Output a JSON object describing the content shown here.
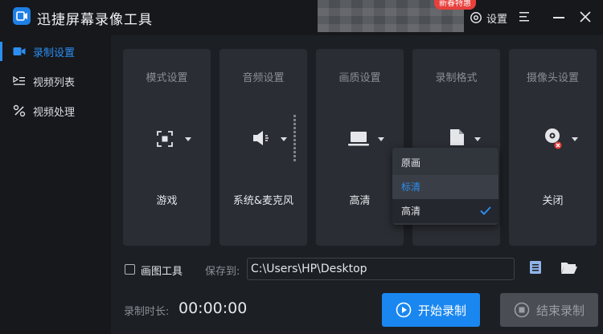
{
  "app": {
    "title": "迅捷屏幕录像工具",
    "promo": "新春特惠"
  },
  "titlebar": {
    "settings_label": "设置"
  },
  "sidebar": {
    "items": [
      {
        "label": "录制设置",
        "icon": "video-camera-icon",
        "active": true
      },
      {
        "label": "视频列表",
        "icon": "video-list-icon",
        "active": false
      },
      {
        "label": "视频处理",
        "icon": "video-tools-icon",
        "active": false
      }
    ]
  },
  "cards": {
    "mode": {
      "title": "模式设置",
      "value": "游戏",
      "icon": "fullscreen-target-icon"
    },
    "audio": {
      "title": "音频设置",
      "value": "系统&麦克风",
      "icon": "speaker-icon"
    },
    "quality": {
      "title": "画质设置",
      "value": "高清",
      "icon": "monitor-icon"
    },
    "format": {
      "title": "录制格式",
      "value": "",
      "icon": "file-icon"
    },
    "camera": {
      "title": "摄像头设置",
      "value": "关闭",
      "icon": "webcam-off-icon"
    }
  },
  "quality_dropdown": {
    "options": [
      "原画",
      "标清",
      "高清"
    ],
    "hovered": "标清",
    "selected": "高清"
  },
  "save": {
    "draw_tool_label": "画图工具",
    "draw_tool_checked": false,
    "save_to_label": "保存到:",
    "path": "C:\\Users\\HP\\Desktop"
  },
  "footer": {
    "duration_label": "录制时长:",
    "duration_value": "00:00:00",
    "start_label": "开始录制",
    "stop_label": "结束录制"
  },
  "colors": {
    "accent": "#1a87f0",
    "background": "#1c1f24",
    "card": "#2a2d33",
    "sidebar": "#16181c"
  }
}
